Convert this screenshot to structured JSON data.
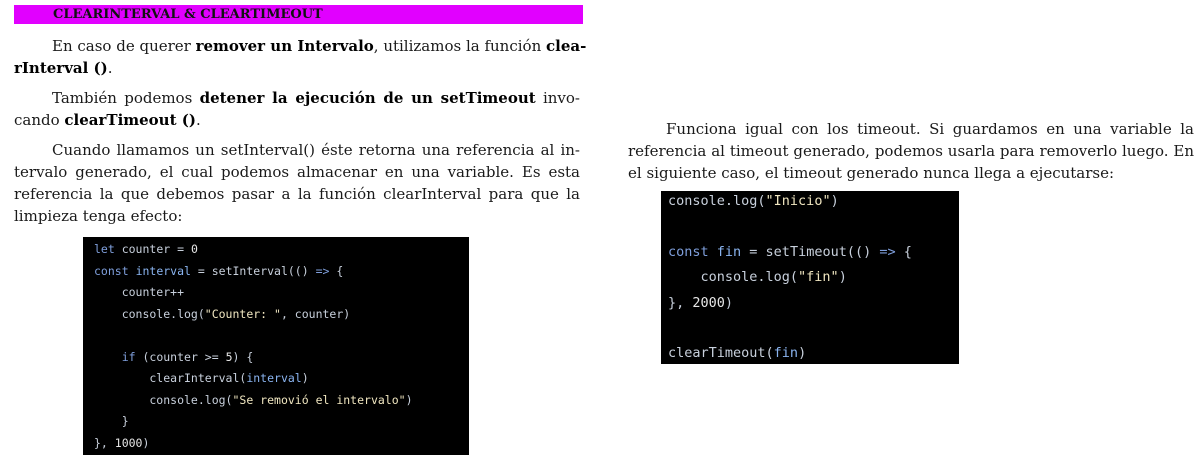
{
  "heading": "CLEARINTERVAL & CLEARTIMEOUT",
  "paragraph1": {
    "line1": {
      "before": "En caso de querer ",
      "bold1": "remover un Intervalo",
      "middle": ", utilizamos la función ",
      "bold2": "clea-"
    },
    "line2": {
      "bold": "rInterval ()",
      "after": "."
    }
  },
  "paragraph2": {
    "line1": {
      "before": "También podemos ",
      "bold": "detener la ejecución de un setTimeout",
      "after": " invo-"
    },
    "line2": {
      "before": "cando ",
      "bold": "clearTimeout ()",
      "after": "."
    }
  },
  "paragraph3": {
    "lines": [
      "Cuando llamamos un setInterval() éste retorna una referencia al in-",
      "tervalo generado, el cual podemos almacenar en una variable. Es esta",
      "referencia la que debemos pasar a la función clearInterval para que la",
      "limpieza tenga efecto:"
    ]
  },
  "paragraph4": {
    "lines": [
      "Funciona igual con los timeout. Si guardamos en una variable la",
      "referencia al timeout generado, podemos usarla para removerlo luego. En",
      "el siguiente caso, el timeout generado nunca llega a ejecutarse:"
    ]
  },
  "code_block_1": {
    "lines": [
      "let counter = 0",
      "const interval = setInterval(() => {",
      "    counter++",
      "    console.log(\"Counter: \", counter)",
      "",
      "    if (counter >= 5) {",
      "        clearInterval(interval)",
      "        console.log(\"Se removió el intervalo\")",
      "    }",
      "}, 1000)"
    ]
  },
  "code_block_2": {
    "lines": [
      "console.log(\"Inicio\")",
      "",
      "const fin = setTimeout(() => {",
      "    console.log(\"fin\")",
      "}, 2000)",
      "",
      "clearTimeout(fin)"
    ]
  }
}
